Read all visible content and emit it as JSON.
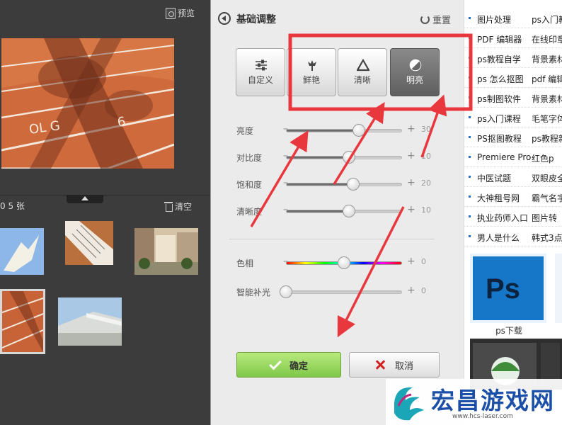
{
  "left_panel": {
    "preview_label": "预览",
    "count_label": "0 5 张",
    "clear_label": "清空"
  },
  "panel": {
    "title": "基础调整",
    "reset_label": "重置",
    "presets": [
      {
        "label": "自定义",
        "icon": "sliders-icon",
        "active": false
      },
      {
        "label": "鲜艳",
        "icon": "flower-icon",
        "active": false
      },
      {
        "label": "清晰",
        "icon": "triangle-icon",
        "active": false
      },
      {
        "label": "明亮",
        "icon": "half-circle-icon",
        "active": true
      }
    ],
    "sliders": [
      {
        "name": "亮度",
        "value": "30",
        "level": 0.63
      },
      {
        "name": "对比度",
        "value": "10",
        "level": 0.54
      },
      {
        "name": "饱和度",
        "value": "20",
        "level": 0.58
      },
      {
        "name": "清晰度",
        "value": "10",
        "level": 0.54
      }
    ],
    "sliders2": [
      {
        "name": "色相",
        "value": "0",
        "level": 0.5,
        "hue": true
      },
      {
        "name": "智能补光",
        "value": "0",
        "level": 0.0,
        "hue": false
      }
    ],
    "ok_label": "确定",
    "cancel_label": "取消"
  },
  "sidebar": {
    "links": [
      [
        "图片处理",
        "ps入门教学"
      ],
      [
        "PDF 编辑器",
        "在线印章"
      ],
      [
        "ps教程自学",
        "背景素材"
      ],
      [
        "ps 怎么抠图",
        "pdf 编辑"
      ],
      [
        "ps制图软件",
        "背景素材"
      ],
      [
        "ps入门课程",
        "毛笔字体"
      ],
      [
        "PS抠图教程",
        "ps教程新"
      ],
      [
        "Premiere Pro",
        "红色p"
      ],
      [
        "中医试题",
        "双眼皮全切"
      ],
      [
        "大神租号网",
        "霸气名字"
      ],
      [
        "执业药师入口",
        "图片转"
      ],
      [
        "男人是什么",
        "韩式3点"
      ]
    ],
    "ps_card_text": "Ps",
    "ps_caption": "ps下载"
  },
  "watermark": {
    "title": "宏昌游戏网",
    "url": "www.hcs-laser.com"
  },
  "colors": {
    "annotation_red": "#e8383d",
    "ok_green": "#8fd14f",
    "ps_blue": "#1677c9"
  }
}
